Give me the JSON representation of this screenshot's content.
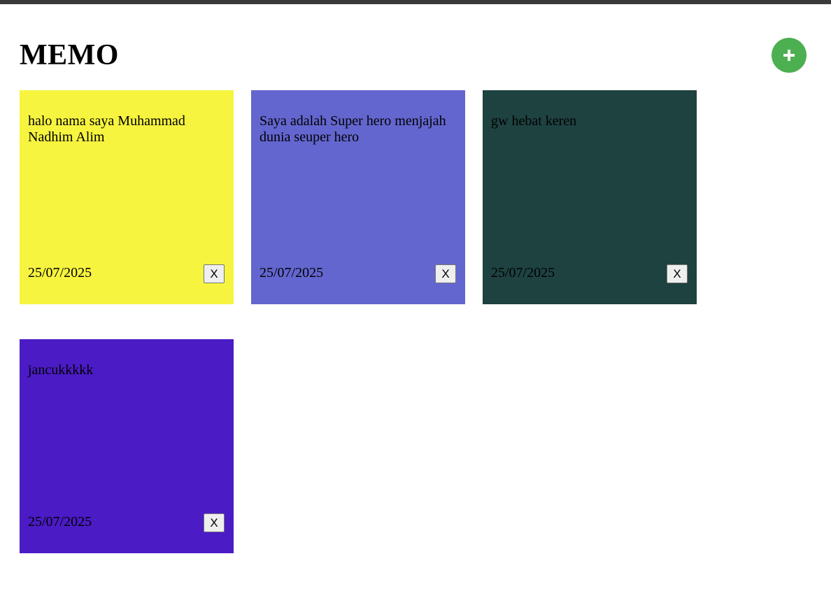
{
  "header": {
    "title": "MEMO",
    "add_button_icon": "plus-icon",
    "add_button_color": "#4caf50"
  },
  "memos": [
    {
      "text": "halo nama saya Muhammad Nadhim Alim",
      "date": "25/07/2025",
      "color": "#f7f43f",
      "delete_label": "X"
    },
    {
      "text": "Saya adalah Super hero menjajah dunia seuper hero",
      "date": "25/07/2025",
      "color": "#6366cf",
      "delete_label": "X"
    },
    {
      "text": "gw hebat keren",
      "date": "25/07/2025",
      "color": "#1e4240",
      "delete_label": "X"
    },
    {
      "text": "jancukkkkk",
      "date": "25/07/2025",
      "color": "#4b1bc6",
      "delete_label": "X"
    }
  ]
}
